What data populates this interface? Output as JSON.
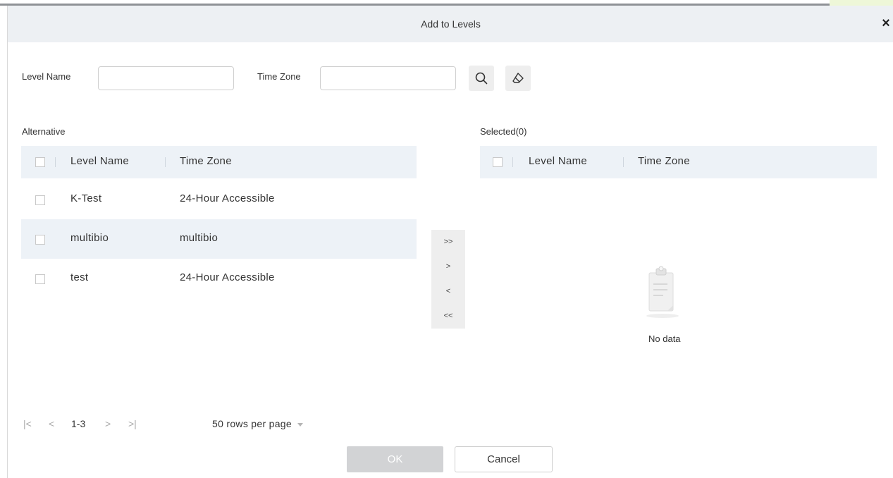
{
  "dialog": {
    "title": "Add to Levels",
    "close_symbol": "×"
  },
  "filters": {
    "level_name_label": "Level Name",
    "level_name_value": "",
    "time_zone_label": "Time Zone",
    "time_zone_value": ""
  },
  "alternative": {
    "title": "Alternative",
    "columns": [
      "Level Name",
      "Time Zone"
    ],
    "rows": [
      {
        "level_name": "K-Test",
        "time_zone": "24-Hour Accessible"
      },
      {
        "level_name": "multibio",
        "time_zone": "multibio"
      },
      {
        "level_name": "test",
        "time_zone": "24-Hour Accessible"
      }
    ]
  },
  "transfer": {
    "all_right": ">>",
    "right": ">",
    "left": "<",
    "all_left": "<<"
  },
  "selected": {
    "title": "Selected(0)",
    "columns": [
      "Level Name",
      "Time Zone"
    ],
    "empty_text": "No data"
  },
  "pagination": {
    "first": "|<",
    "prev": "<",
    "range": "1-3",
    "next": ">",
    "last": ">|",
    "rows_per_page": "50 rows per page"
  },
  "actions": {
    "ok": "OK",
    "cancel": "Cancel"
  },
  "colors": {
    "header_bg": "#edf0f3",
    "row_highlight": "#edf2f7",
    "ok_disabled": "#d2d3d5"
  },
  "icons": {
    "search": "search-icon",
    "clear": "eraser-icon",
    "close": "close-icon",
    "empty": "clipboard-icon",
    "dropdown": "caret-down-icon"
  }
}
